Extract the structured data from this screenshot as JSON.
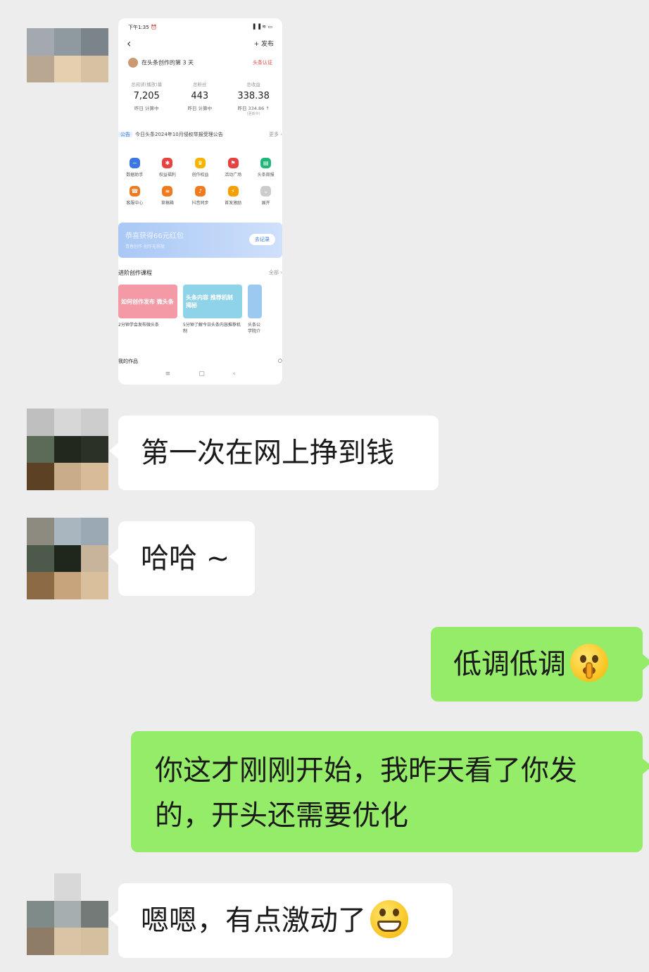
{
  "screenshot": {
    "status_time": "下午1:35 ⏰",
    "status_icons": "▐ ▐ ≋ ▭",
    "back_icon": "‹",
    "publish_label": "+ 发布",
    "profile_text": "在头条创作的第 3 天",
    "profile_badge": "头条认证",
    "stats": [
      {
        "label": "总阅读(播放)量",
        "value": "7,205",
        "sub": "昨日 计算中"
      },
      {
        "label": "总粉丝",
        "value": "443",
        "sub": "昨日 计算中"
      },
      {
        "label": "总收益",
        "value": "338.38",
        "sub": "昨日 334.86 ↑"
      }
    ],
    "stats_note": "(更新中)",
    "notice_tag": "公告",
    "notice_text": "今日头条2024年10月侵权举报受理公告",
    "notice_more": "更多 ›",
    "tools": [
      {
        "label": "数据助手",
        "color": "#3a78e0",
        "glyph": "~"
      },
      {
        "label": "权益福利",
        "color": "#e64340",
        "glyph": "✱"
      },
      {
        "label": "创作权益",
        "color": "#f5b400",
        "glyph": "♛"
      },
      {
        "label": "活动广场",
        "color": "#e64340",
        "glyph": "⚑"
      },
      {
        "label": "头条周报",
        "color": "#1fb67a",
        "glyph": "▤"
      },
      {
        "label": "客服中心",
        "color": "#f07a1e",
        "glyph": "☎"
      },
      {
        "label": "草稿箱",
        "color": "#f07a1e",
        "glyph": "≡"
      },
      {
        "label": "抖音同步",
        "color": "#f07a1e",
        "glyph": "♪"
      },
      {
        "label": "首发激励",
        "color": "#f5a000",
        "glyph": "⚡"
      },
      {
        "label": "展开",
        "color": "#cccccc",
        "glyph": "⌄"
      }
    ],
    "banner_title": "恭喜获得66元红包",
    "banner_sub": "青春创作 创作无界限",
    "banner_button": "去记录",
    "courses_title": "进阶创作课程",
    "courses_more": "全部 ›",
    "courses": [
      {
        "img_text": "如何创作发布 微头条",
        "caption": "2分钟学会发布微头条",
        "color": "#f39aa6"
      },
      {
        "img_text": "头条内容 推荐机制 揭秘",
        "caption": "5分钟了解今日头条内容推荐机制",
        "color": "#8fd3e8"
      },
      {
        "img_text": "",
        "caption": "头条公 学院介",
        "color": "#9cc9f0"
      }
    ],
    "works_title": "我的作品",
    "works_icon": "○",
    "nav_icons": [
      "≡",
      "▢",
      "‹"
    ]
  },
  "messages": [
    {
      "side": "in",
      "text": "第一次在网上挣到钱",
      "emoji": ""
    },
    {
      "side": "in",
      "text": "哈哈 ~",
      "emoji": ""
    },
    {
      "side": "out",
      "text": "低调低调",
      "emoji": "shushing-face-icon"
    },
    {
      "side": "out",
      "text": "你这才刚刚开始，我昨天看了你发的，开头还需要优化",
      "emoji": ""
    },
    {
      "side": "in",
      "text": "嗯嗯，有点激动了",
      "emoji": "grinning-face-icon"
    }
  ]
}
